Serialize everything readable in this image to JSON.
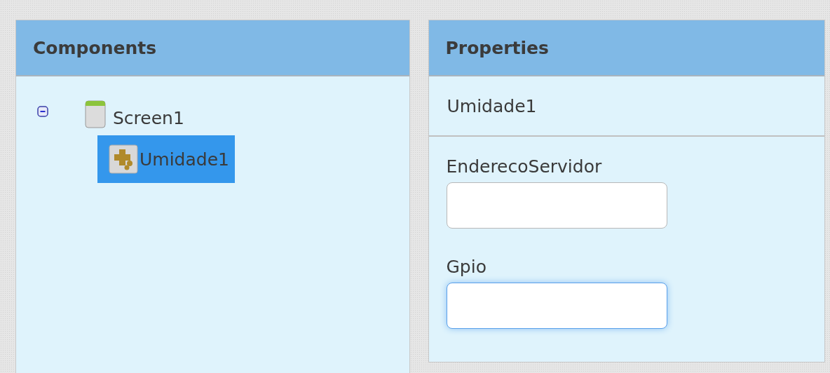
{
  "components": {
    "title": "Components",
    "tree": [
      {
        "label": "Screen1",
        "kind": "screen",
        "expanded": true,
        "selected": false,
        "children": [
          {
            "label": "Umidade1",
            "kind": "extension",
            "selected": true
          }
        ]
      }
    ]
  },
  "properties": {
    "title": "Properties",
    "component": "Umidade1",
    "fields": [
      {
        "label": "EnderecoServidor",
        "focused": false
      },
      {
        "label": "Gpio",
        "focused": true
      }
    ]
  }
}
